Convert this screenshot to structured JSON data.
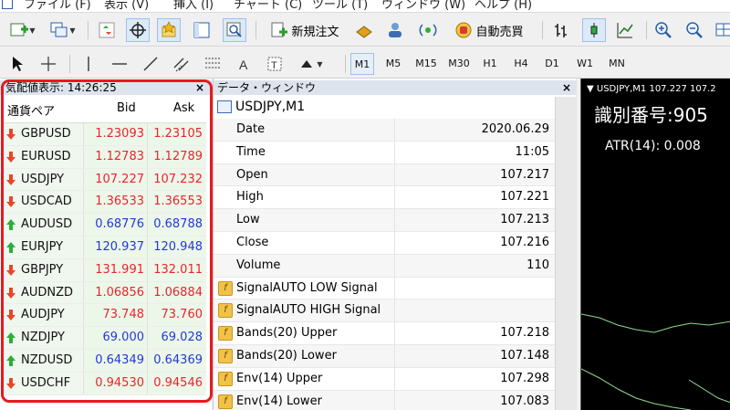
{
  "menu": [
    "ファイル (F)",
    "表示 (V)",
    "挿入 (I)",
    "チャート (C)",
    "ツール (T)",
    "ウィンドウ (W)",
    "ヘルプ (H)"
  ],
  "toolbar": {
    "new_order_label": "新規注文",
    "auto_trade_label": "自動売買"
  },
  "timeframes": [
    "M1",
    "M5",
    "M15",
    "M30",
    "H1",
    "H4",
    "D1",
    "W1",
    "MN"
  ],
  "market_watch": {
    "title": "気配値表示: 14:26:25",
    "close": "×",
    "columns": {
      "symbol": "通貨ペア",
      "bid": "Bid",
      "ask": "Ask"
    },
    "rows": [
      {
        "symbol": "GBPUSD",
        "bid": "1.23093",
        "ask": "1.23105",
        "dir": "down"
      },
      {
        "symbol": "EURUSD",
        "bid": "1.12783",
        "ask": "1.12789",
        "dir": "down"
      },
      {
        "symbol": "USDJPY",
        "bid": "107.227",
        "ask": "107.232",
        "dir": "down"
      },
      {
        "symbol": "USDCAD",
        "bid": "1.36533",
        "ask": "1.36553",
        "dir": "down"
      },
      {
        "symbol": "AUDUSD",
        "bid": "0.68776",
        "ask": "0.68788",
        "dir": "up"
      },
      {
        "symbol": "EURJPY",
        "bid": "120.937",
        "ask": "120.948",
        "dir": "up"
      },
      {
        "symbol": "GBPJPY",
        "bid": "131.991",
        "ask": "132.011",
        "dir": "down"
      },
      {
        "symbol": "AUDNZD",
        "bid": "1.06856",
        "ask": "1.06884",
        "dir": "down"
      },
      {
        "symbol": "AUDJPY",
        "bid": "73.748",
        "ask": "73.760",
        "dir": "down"
      },
      {
        "symbol": "NZDJPY",
        "bid": "69.000",
        "ask": "69.028",
        "dir": "up"
      },
      {
        "symbol": "NZDUSD",
        "bid": "0.64349",
        "ask": "0.64369",
        "dir": "up"
      },
      {
        "symbol": "USDCHF",
        "bid": "0.94530",
        "ask": "0.94546",
        "dir": "down"
      }
    ]
  },
  "data_window": {
    "title": "データ・ウィンドウ",
    "close": "×",
    "symbol": "USDJPY,M1",
    "rows": [
      {
        "key": "Date",
        "value": "2020.06.29",
        "indicator": false
      },
      {
        "key": "Time",
        "value": "11:05",
        "indicator": false
      },
      {
        "key": "Open",
        "value": "107.217",
        "indicator": false
      },
      {
        "key": "High",
        "value": "107.221",
        "indicator": false
      },
      {
        "key": "Low",
        "value": "107.213",
        "indicator": false
      },
      {
        "key": "Close",
        "value": "107.216",
        "indicator": false
      },
      {
        "key": "Volume",
        "value": "110",
        "indicator": false
      },
      {
        "key": "SignalAUTO LOW Signal",
        "value": "",
        "indicator": true
      },
      {
        "key": "SignalAUTO HIGH Signal",
        "value": "",
        "indicator": true
      },
      {
        "key": "Bands(20) Upper",
        "value": "107.218",
        "indicator": true
      },
      {
        "key": "Bands(20) Lower",
        "value": "107.148",
        "indicator": true
      },
      {
        "key": "Env(14) Upper",
        "value": "107.298",
        "indicator": true
      },
      {
        "key": "Env(14) Lower",
        "value": "107.083",
        "indicator": true
      }
    ]
  },
  "chart": {
    "header": "USDJPY,M1  107.227 107.2",
    "overlay_text": "識別番号:905",
    "atr_text": "ATR(14): 0.008",
    "line_color": "#8fd98f",
    "background": "#000000"
  },
  "colors": {
    "up": "#2cae3a",
    "down": "#e8452a",
    "bid_red": "#e8252c",
    "bid_blue": "#2538d6",
    "highlight": "#e8191f"
  }
}
